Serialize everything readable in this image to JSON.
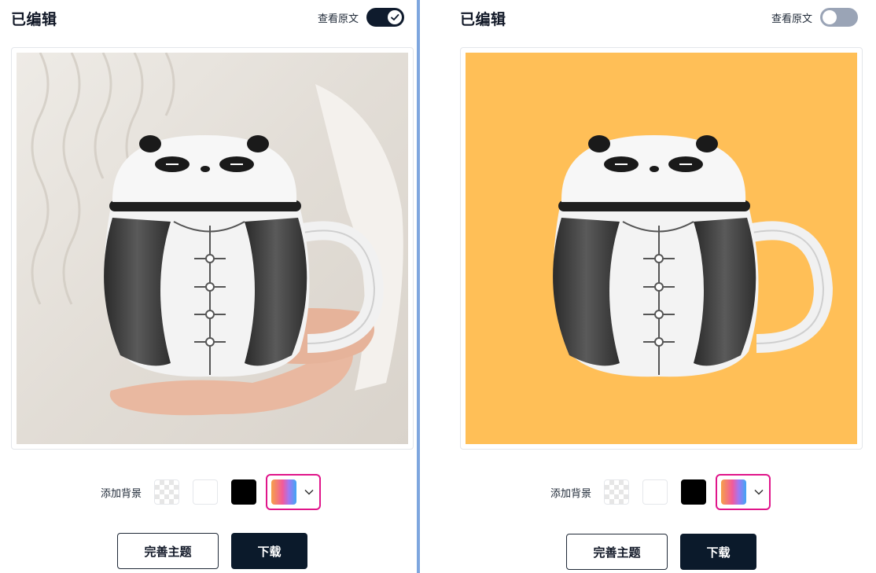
{
  "left_panel": {
    "title": "已编辑",
    "toggle_label": "查看原文",
    "toggle_state": "on",
    "bg_label": "添加背景",
    "refine_button": "完善主题",
    "download_button": "下载"
  },
  "right_panel": {
    "title": "已编辑",
    "toggle_label": "查看原文",
    "toggle_state": "off",
    "bg_label": "添加背景",
    "refine_button": "完善主题",
    "download_button": "下载",
    "background_color": "#ffbf57"
  },
  "colors": {
    "accent_border": "#e0158a",
    "primary_button": "#0b1a2b",
    "divider": "#7ea6de"
  },
  "icons": [
    "check-icon",
    "chevron-down-icon"
  ]
}
